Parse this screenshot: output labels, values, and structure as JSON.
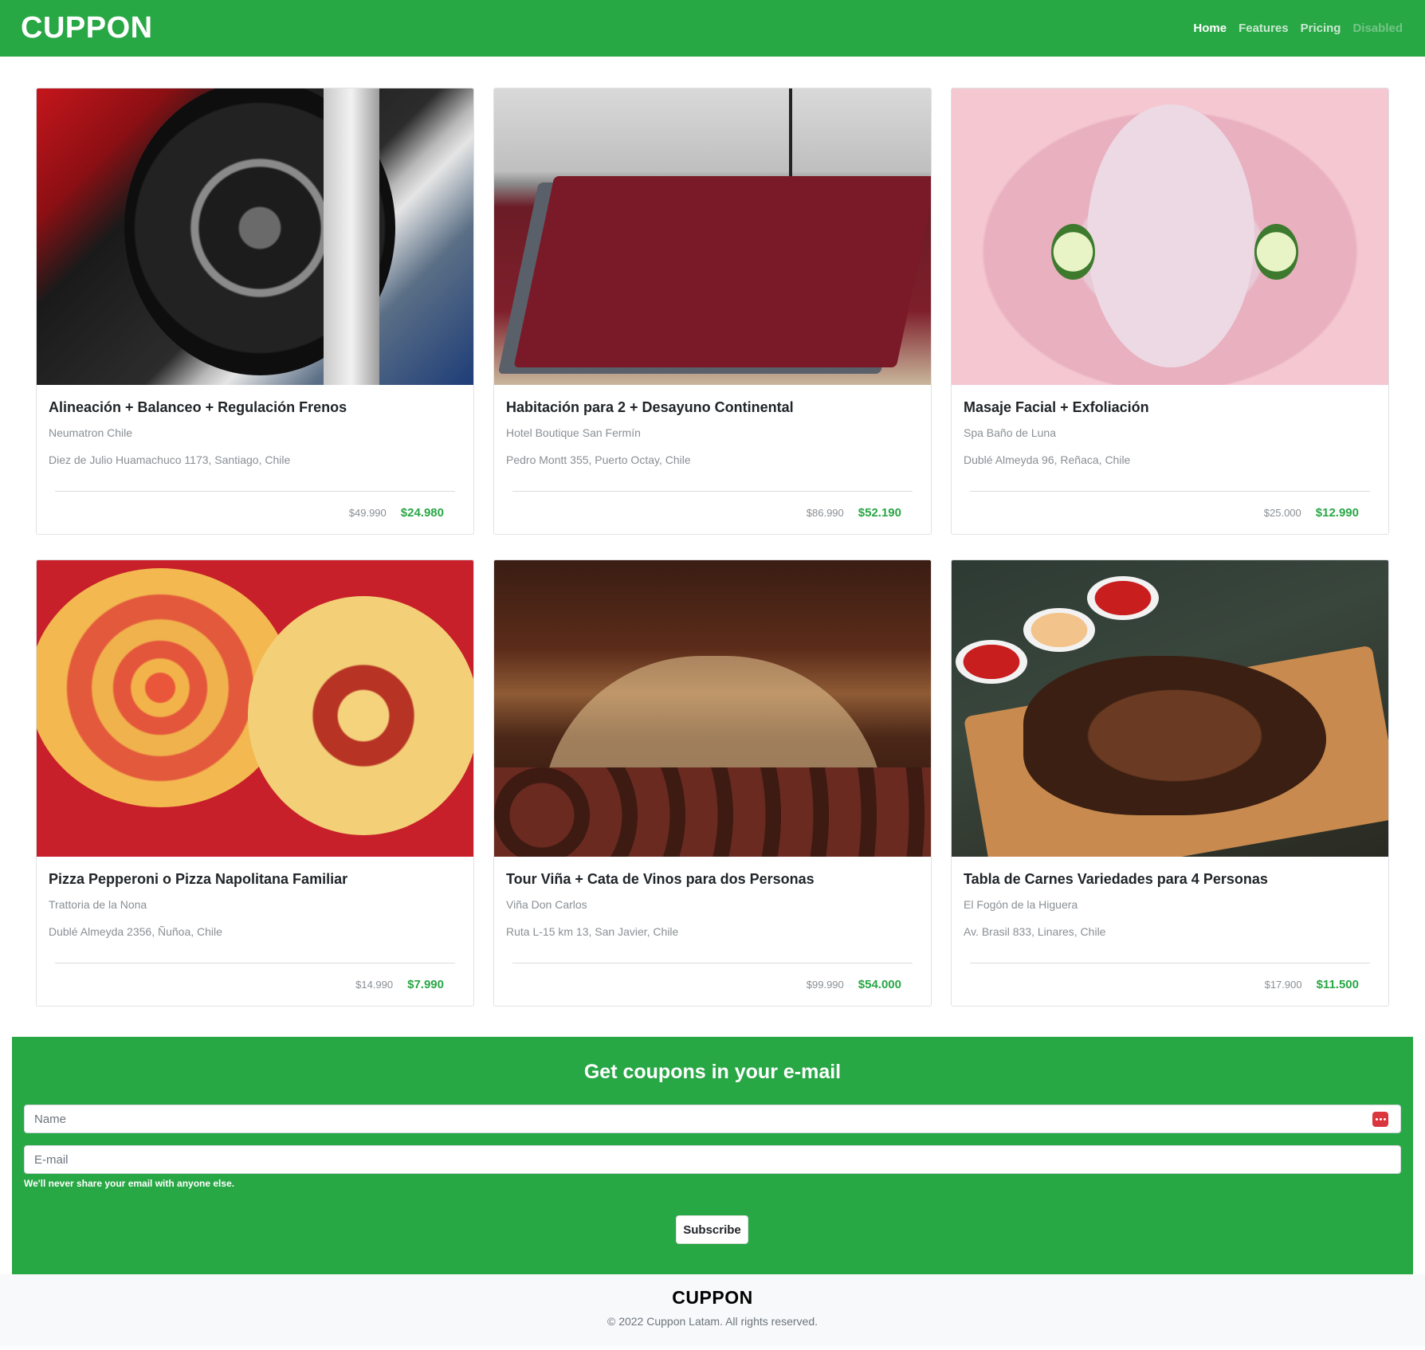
{
  "header": {
    "brand": "CUPPON",
    "nav": [
      {
        "label": "Home",
        "state": "active"
      },
      {
        "label": "Features",
        "state": "normal"
      },
      {
        "label": "Pricing",
        "state": "normal"
      },
      {
        "label": "Disabled",
        "state": "disabled"
      }
    ]
  },
  "cards": [
    {
      "title": "Alineación + Balanceo + Regulación Frenos",
      "merchant": "Neumatron Chile",
      "address": "Diez de Julio Huamachuco 1173, Santiago, Chile",
      "old_price": "$49.990",
      "new_price": "$24.980",
      "image": "car-wheel-alignment"
    },
    {
      "title": "Habitación para 2 + Desayuno Continental",
      "merchant": "Hotel Boutique San Fermín",
      "address": "Pedro Montt 355, Puerto Octay, Chile",
      "old_price": "$86.990",
      "new_price": "$52.190",
      "image": "hotel-bed"
    },
    {
      "title": "Masaje Facial + Exfoliación",
      "merchant": "Spa Baño de Luna",
      "address": "Dublé Almeyda 96, Reñaca, Chile",
      "old_price": "$25.000",
      "new_price": "$12.990",
      "image": "facial-mask"
    },
    {
      "title": "Pizza Pepperoni o Pizza Napolitana Familiar",
      "merchant": "Trattoria de la Nona",
      "address": "Dublé Almeyda 2356, Ñuñoa, Chile",
      "old_price": "$14.990",
      "new_price": "$7.990",
      "image": "pizzas"
    },
    {
      "title": "Tour Viña + Cata de Vinos para dos Personas",
      "merchant": "Viña Don Carlos",
      "address": "Ruta L-15 km 13, San Javier, Chile",
      "old_price": "$99.990",
      "new_price": "$54.000",
      "image": "wine-cellar-barrels"
    },
    {
      "title": "Tabla de Carnes Variedades para 4 Personas",
      "merchant": "El Fogón de la Higuera",
      "address": "Av. Brasil 833, Linares, Chile",
      "old_price": "$17.900",
      "new_price": "$11.500",
      "image": "grilled-meat-board"
    }
  ],
  "subscribe": {
    "title": "Get coupons in your e-mail",
    "name_placeholder": "Name",
    "email_placeholder": "E-mail",
    "help_text": "We'll never share your email with anyone else.",
    "button_label": "Subscribe",
    "name_field_icon": "password-manager-icon"
  },
  "footer": {
    "brand": "CUPPON",
    "copyright": "© 2022 Cuppon Latam. All rights reserved."
  },
  "colors": {
    "brand_green": "#28a745",
    "price_green": "#28a745",
    "muted_text": "#8a8f94",
    "footer_bg": "#f8f9fa"
  }
}
